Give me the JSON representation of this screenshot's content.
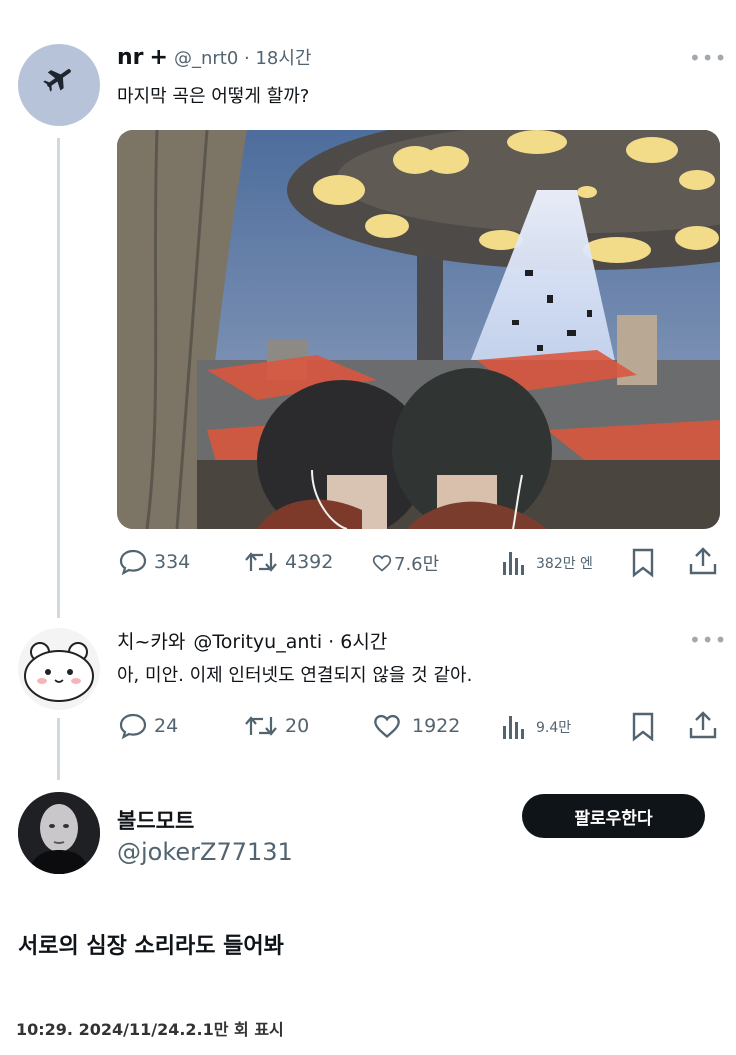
{
  "tweet1": {
    "author_name": "nr",
    "plus": "+",
    "handle_time": "@_nrt0 · 18시간",
    "text": "마지막 곡은 어떻게 할까?",
    "replies": "334",
    "retweets": "4392",
    "likes": "7.6만",
    "views": "382만 엔"
  },
  "tweet2": {
    "author_name": "치~카와",
    "handle_time": "@Torityu_anti · 6시간",
    "text": "아, 미안. 이제 인터넷도 연결되지 않을 것 같아.",
    "replies": "24",
    "retweets": "20",
    "likes": "1922",
    "views": "9.4만"
  },
  "tweet3": {
    "author_name": "볼드모트",
    "handle": "@jokerZ77131",
    "follow_label": "팔로우한다",
    "text": "서로의 심장 소리라도 들어봐",
    "timestamp": "10:29. 2024/11/24.2.1만 회 표시"
  },
  "more_glyph": "•••",
  "colors": {
    "accent": "#0f1419",
    "muted": "#536471",
    "thread_line": "#cfd9de"
  }
}
